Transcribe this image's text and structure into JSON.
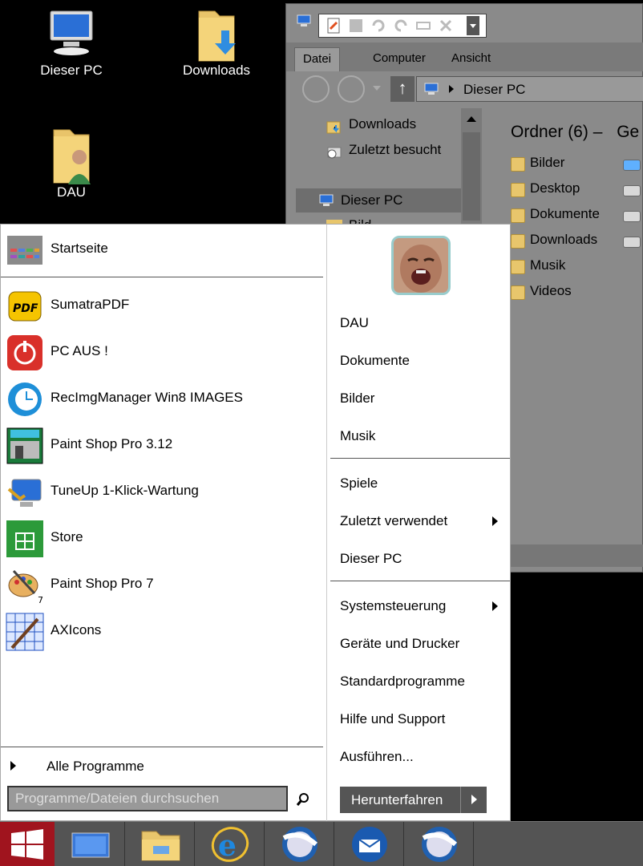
{
  "desktop": {
    "icons": [
      {
        "label": "Dieser PC",
        "icon": "computer-icon"
      },
      {
        "label": "Downloads",
        "icon": "downloads-folder-icon"
      },
      {
        "label": "DAU",
        "icon": "user-folder-icon"
      }
    ]
  },
  "explorer": {
    "ribbon_tabs": [
      "Datei",
      "Computer",
      "Ansicht"
    ],
    "address": "Dieser PC",
    "nav_items": [
      "Downloads",
      "Zuletzt besucht",
      "Dieser PC",
      "Bild"
    ],
    "group_title": "Ordner (6) –",
    "group_title_2": "Ge",
    "folders": [
      "Bilder",
      "Desktop",
      "Dokumente",
      "Downloads",
      "Musik",
      "Videos"
    ]
  },
  "start_menu": {
    "pinned": [
      {
        "label": "Startseite",
        "icon": "start-screen-icon"
      }
    ],
    "programs": [
      {
        "label": "SumatraPDF",
        "icon": "pdf-icon"
      },
      {
        "label": "PC AUS !",
        "icon": "power-icon"
      },
      {
        "label": "RecImgManager Win8 IMAGES",
        "icon": "restore-icon"
      },
      {
        "label": "Paint Shop Pro 3.12",
        "icon": "paint-shop-icon"
      },
      {
        "label": "TuneUp 1-Klick-Wartung",
        "icon": "tuneup-icon"
      },
      {
        "label": "Store",
        "icon": "store-icon"
      },
      {
        "label": "Paint Shop Pro 7",
        "icon": "palette-icon"
      },
      {
        "label": "AXIcons",
        "icon": "axicons-icon"
      }
    ],
    "all_programs": "Alle Programme",
    "search_placeholder": "Programme/Dateien durchsuchen",
    "right_items": [
      {
        "label": "DAU",
        "submenu": false
      },
      {
        "label": "Dokumente",
        "submenu": false
      },
      {
        "label": "Bilder",
        "submenu": false
      },
      {
        "label": "Musik",
        "submenu": false
      },
      {
        "label": "Spiele",
        "submenu": false
      },
      {
        "label": "Zuletzt verwendet",
        "submenu": true
      },
      {
        "label": "Dieser PC",
        "submenu": false
      },
      {
        "label": "Systemsteuerung",
        "submenu": true
      },
      {
        "label": "Geräte und Drucker",
        "submenu": false
      },
      {
        "label": "Standardprogramme",
        "submenu": false
      },
      {
        "label": "Hilfe und Support",
        "submenu": false
      },
      {
        "label": "Ausführen...",
        "submenu": false
      }
    ],
    "shutdown": "Herunterfahren"
  },
  "taskbar": {
    "items": [
      "start-button",
      "desktop-icon",
      "file-explorer-icon",
      "internet-explorer-icon",
      "browser-icon",
      "thunderbird-icon",
      "browser-2-icon"
    ]
  },
  "colors": {
    "start_button": "#a0141e",
    "taskbar": "#545454",
    "folder": "#e8c66c"
  }
}
